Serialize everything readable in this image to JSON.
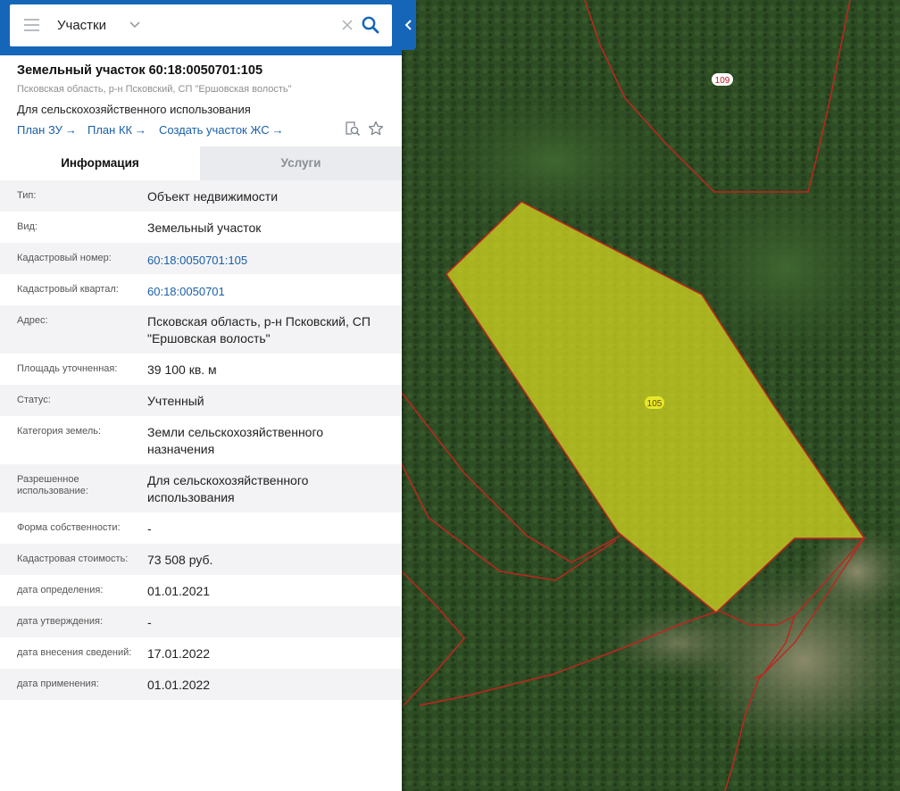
{
  "search": {
    "value": "Участки",
    "menu_icon": "hamburger-icon",
    "dropdown_icon": "chevron-down-icon",
    "clear_icon": "close-icon",
    "search_icon": "search-icon"
  },
  "panel_toggle_icon": "chevron-left-icon",
  "object": {
    "title": "Земельный участок 60:18:0050701:105",
    "address": "Псковская область, р-н Псковский, СП \"Ершовская волость\"",
    "usage": "Для сельскохозяйственного использования"
  },
  "actions": {
    "plan_zu": "План ЗУ",
    "plan_kk": "План КК",
    "create_zhs": "Создать участок ЖС",
    "arrow": "→"
  },
  "tabs": [
    {
      "label": "Информация",
      "active": true
    },
    {
      "label": "Услуги",
      "active": false
    }
  ],
  "info": [
    {
      "label": "Тип:",
      "value": "Объект недвижимости"
    },
    {
      "label": "Вид:",
      "value": "Земельный участок"
    },
    {
      "label": "Кадастровый номер:",
      "value": "60:18:0050701:105",
      "link": true
    },
    {
      "label": "Кадастровый квартал:",
      "value": "60:18:0050701",
      "link": true
    },
    {
      "label": "Адрес:",
      "value": "Псковская область, р-н Псковский, СП \"Ершовская волость\""
    },
    {
      "label": "Площадь уточненная:",
      "value": "39 100 кв. м"
    },
    {
      "label": "Статус:",
      "value": "Учтенный"
    },
    {
      "label": "Категория земель:",
      "value": "Земли сельскохозяйственного назначения"
    },
    {
      "label": "Разрешенное использование:",
      "value": "Для сельскохозяйственного использования"
    },
    {
      "label": "Форма собственности:",
      "value": "-"
    },
    {
      "label": "Кадастровая стоимость:",
      "value": "73 508 руб."
    },
    {
      "label": "дата определения:",
      "value": "01.01.2021"
    },
    {
      "label": "дата утверждения:",
      "value": "-"
    },
    {
      "label": "дата внесения сведений:",
      "value": "17.01.2022"
    },
    {
      "label": "дата применения:",
      "value": "01.01.2022"
    }
  ],
  "map": {
    "labels": [
      "109",
      "105"
    ],
    "colors": {
      "forest": "#2c4a22",
      "boundary": "#c0251f",
      "selected_fill": "#d9dc1e",
      "accent": "#1565b8",
      "link": "#1a5fa8"
    }
  }
}
